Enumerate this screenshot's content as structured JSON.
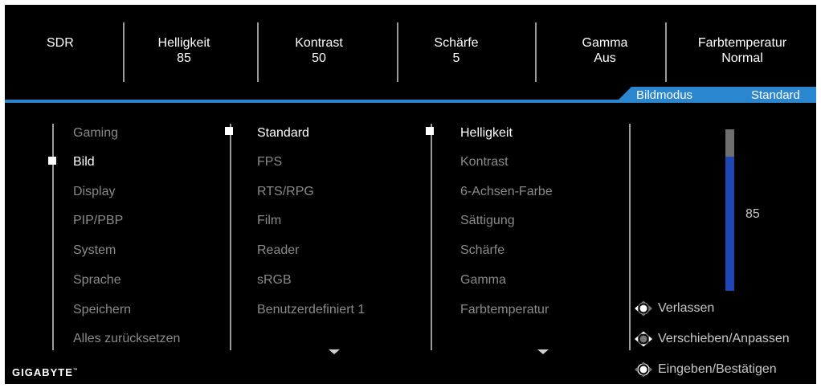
{
  "status_bar": {
    "mode": "SDR",
    "items": [
      {
        "label": "Helligkeit",
        "value": "85"
      },
      {
        "label": "Kontrast",
        "value": "50"
      },
      {
        "label": "Schärfe",
        "value": "5"
      },
      {
        "label": "Gamma",
        "value": "Aus"
      },
      {
        "label": "Farbtemperatur",
        "value": "Normal"
      }
    ]
  },
  "header_tab": {
    "label": "Bildmodus",
    "value": "Standard"
  },
  "menu_main": [
    "Gaming",
    "Bild",
    "Display",
    "PIP/PBP",
    "System",
    "Sprache",
    "Speichern",
    "Alles zurücksetzen"
  ],
  "menu_sub": [
    "Standard",
    "FPS",
    "RTS/RPG",
    "Film",
    "Reader",
    "sRGB",
    "Benutzerdefiniert 1"
  ],
  "menu_settings": [
    "Helligkeit",
    "Kontrast",
    "6-Achsen-Farbe",
    "Sättigung",
    "Schärfe",
    "Gamma",
    "Farbtemperatur"
  ],
  "slider": {
    "value": "85",
    "level": 85
  },
  "hints": [
    {
      "icon": "joystick-left-icon",
      "label": "Verlassen"
    },
    {
      "icon": "joystick-all-icon",
      "label": "Verschieben/Anpassen"
    },
    {
      "icon": "joystick-press-icon",
      "label": "Eingeben/Bestätigen"
    }
  ],
  "brand": {
    "logo": "GIGABYTE",
    "tm": "™"
  },
  "colors": {
    "accent": "#2b86d0",
    "slider_fill": "#1e47b5",
    "background": "#000000"
  }
}
